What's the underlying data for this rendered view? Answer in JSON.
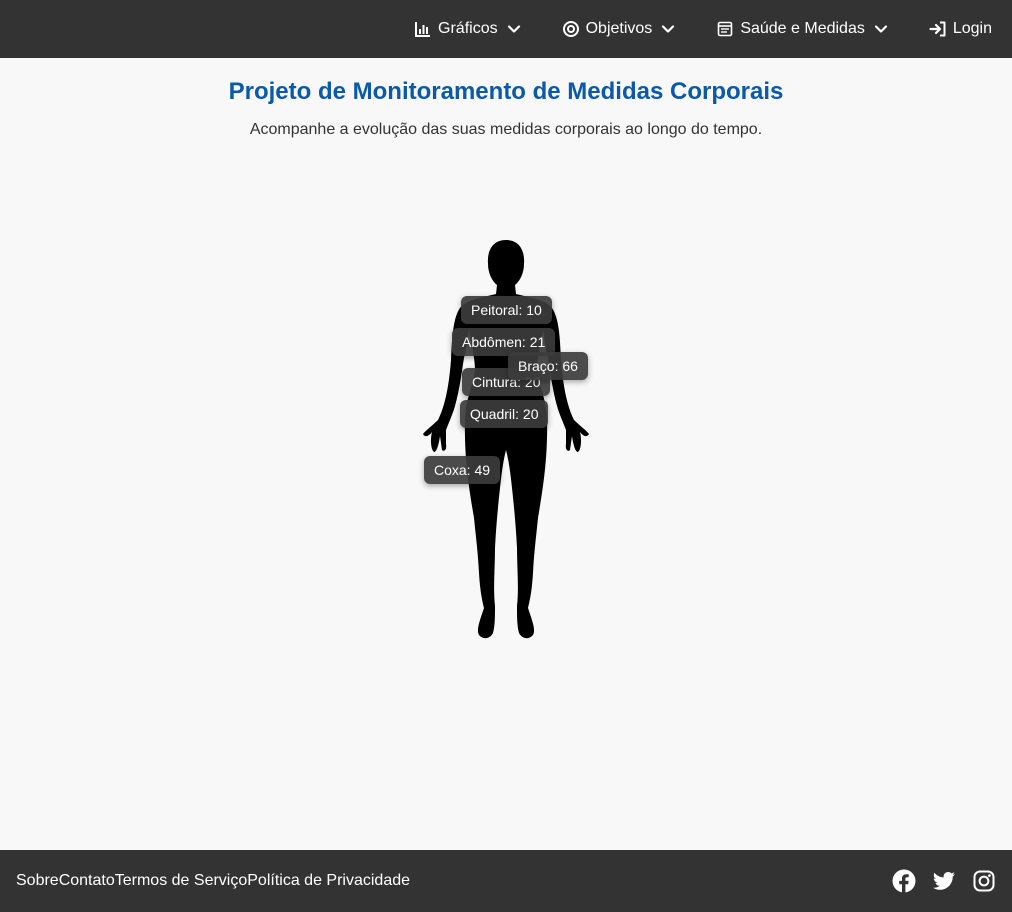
{
  "nav": {
    "items": [
      {
        "label": "Gráficos",
        "icon": "bar-chart-icon"
      },
      {
        "label": "Objetivos",
        "icon": "target-icon"
      },
      {
        "label": "Saúde e Medidas",
        "icon": "clipboard-icon"
      },
      {
        "label": "Login",
        "icon": "login-icon"
      }
    ]
  },
  "header": {
    "title": "Projeto de Monitoramento de Medidas Corporais",
    "subtitle": "Acompanhe a evolução das suas medidas corporais ao longo do tempo."
  },
  "measurements": {
    "peitoral": "Peitoral: 10",
    "abdomen": "Abdômen: 21",
    "braco": "Braço: 66",
    "cintura": "Cintura: 20",
    "quadril": "Quadril: 20",
    "coxa": "Coxa: 49"
  },
  "footer": {
    "links": [
      "Sobre",
      "Contato",
      "Termos de Serviço",
      "Política de Privacidade"
    ],
    "socials": [
      "facebook-icon",
      "twitter-icon",
      "instagram-icon"
    ]
  },
  "colors": {
    "navbar": "#333333",
    "title": "#0a5aa8",
    "background": "#f8f8f8",
    "tag": "#3c3c3c"
  }
}
